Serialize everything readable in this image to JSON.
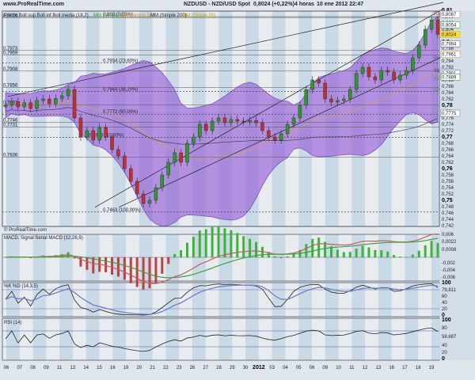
{
  "header": {
    "site": "www.ProRealTime.com",
    "title": "NZDUSD - NZD/USD Spot",
    "price": "0,8024 (+0,22%)",
    "timeframe": "4 horas",
    "datetime": "10 ene 2012 22:47"
  },
  "legend": {
    "main": "Precio Boll sup Boll inf Boll media (18,2)",
    "ma1": "MM (Simple 4)",
    "ma2": "MM (Simple 50)",
    "ma3": "MM (Simple 200)",
    "ma4": "MM (Simple 55)",
    "watermark": "© ProRealTime.com"
  },
  "left_labels": [
    "0,8076",
    "0,7973",
    "0,7959",
    "0,7908",
    "0,7856",
    "0,7801",
    "0,7746",
    "0,7731",
    "0,7636"
  ],
  "fib_labels": [
    "0,808 (0,00%)",
    "0,7934 (23,60%)",
    "0,7844 (38,20%)",
    "0,7772 (50,00%)",
    "0,7699 (61,80%)",
    "0,7463 (100,00%)"
  ],
  "pivot_labels": [
    "R2",
    "Pv",
    "S1",
    "S2",
    "S3"
  ],
  "right_axis": {
    "ticks": [
      "0,81",
      "0,808",
      "0,806",
      "0,804",
      "0,802",
      "0,8",
      "0,798",
      "0,796",
      "0,794",
      "0,792",
      "0,79",
      "0,788",
      "0,786",
      "0,784",
      "0,782",
      "0,78",
      "0,778",
      "0,776",
      "0,774",
      "0,772",
      "0,77",
      "0,768",
      "0,766",
      "0,764",
      "0,762",
      "0,76",
      "0,758",
      "0,756",
      "0,754",
      "0,752",
      "0,75",
      "0,748",
      "0,746",
      "0,744",
      "0,742"
    ],
    "boxes": [
      {
        "v": "0,8087",
        "c": "#c080c0"
      },
      {
        "v": "0,8054",
        "c": "#40a040"
      },
      {
        "v": "0,8024",
        "c": "#e0c000"
      },
      {
        "v": "0,7994",
        "c": "#8060c0"
      },
      {
        "v": "0,7961",
        "c": "#d0a040"
      },
      {
        "v": "0,7901",
        "c": "#8060c0"
      },
      {
        "v": "0,7889",
        "c": "#40a040"
      },
      {
        "v": "0,7775",
        "c": "#808080"
      }
    ]
  },
  "macd": {
    "label": "MACD, Signal Serial MACD (12,26,9)",
    "ticks": [
      "0,006",
      "0,0022",
      "0,0008",
      "-0,002",
      "-0,004",
      "-0,006"
    ]
  },
  "stoch": {
    "label": "%K %D (14,3,5)",
    "ticks": [
      "100",
      "79,811",
      "60",
      "40",
      "20",
      "0"
    ]
  },
  "rsi": {
    "label": "RSI (14)",
    "ticks": [
      "100",
      "80",
      "58,687",
      "40",
      "20",
      "0"
    ]
  },
  "x_labels": [
    "06",
    "07",
    "08",
    "09",
    "11",
    "13",
    "14",
    "15",
    "16",
    "19",
    "20",
    "21",
    "22",
    "23",
    "26",
    "27",
    "28",
    "29",
    "30",
    "2012",
    "03",
    "04",
    "05",
    "06",
    "09",
    "10",
    "11",
    "12",
    "13",
    "16",
    "17",
    "18",
    "19"
  ],
  "chart_data": {
    "type": "candlestick",
    "title": "NZDUSD - NZD/USD Spot",
    "ylim": [
      0.742,
      0.81
    ],
    "closes": [
      0.78,
      0.7812,
      0.7795,
      0.7808,
      0.779,
      0.7815,
      0.782,
      0.7805,
      0.7822,
      0.783,
      0.785,
      0.776,
      0.77,
      0.772,
      0.769,
      0.773,
      0.77,
      0.766,
      0.764,
      0.76,
      0.756,
      0.752,
      0.749,
      0.75,
      0.754,
      0.758,
      0.762,
      0.765,
      0.762,
      0.768,
      0.77,
      0.774,
      0.772,
      0.775,
      0.776,
      0.7745,
      0.7755,
      0.775,
      0.7748,
      0.7752,
      0.7745,
      0.772,
      0.77,
      0.769,
      0.771,
      0.774,
      0.776,
      0.78,
      0.785,
      0.788,
      0.787,
      0.782,
      0.781,
      0.7815,
      0.782,
      0.785,
      0.79,
      0.792,
      0.789,
      0.788,
      0.791,
      0.7905,
      0.788,
      0.7895,
      0.791,
      0.795,
      0.799,
      0.804,
      0.807,
      0.8024
    ],
    "fib_levels": [
      0.808,
      0.7934,
      0.7844,
      0.7772,
      0.7699,
      0.7463
    ],
    "left_levels": [
      0.8076,
      0.7973,
      0.7959,
      0.7908,
      0.7856,
      0.7801,
      0.7746,
      0.7731,
      0.7636
    ],
    "right_box_values": [
      0.8087,
      0.8054,
      0.8024,
      0.7994,
      0.7961,
      0.7901,
      0.7889,
      0.7775
    ],
    "colors": {
      "bands": "#9a6ad8",
      "up": "#2a9a2a",
      "down": "#c03030"
    }
  }
}
